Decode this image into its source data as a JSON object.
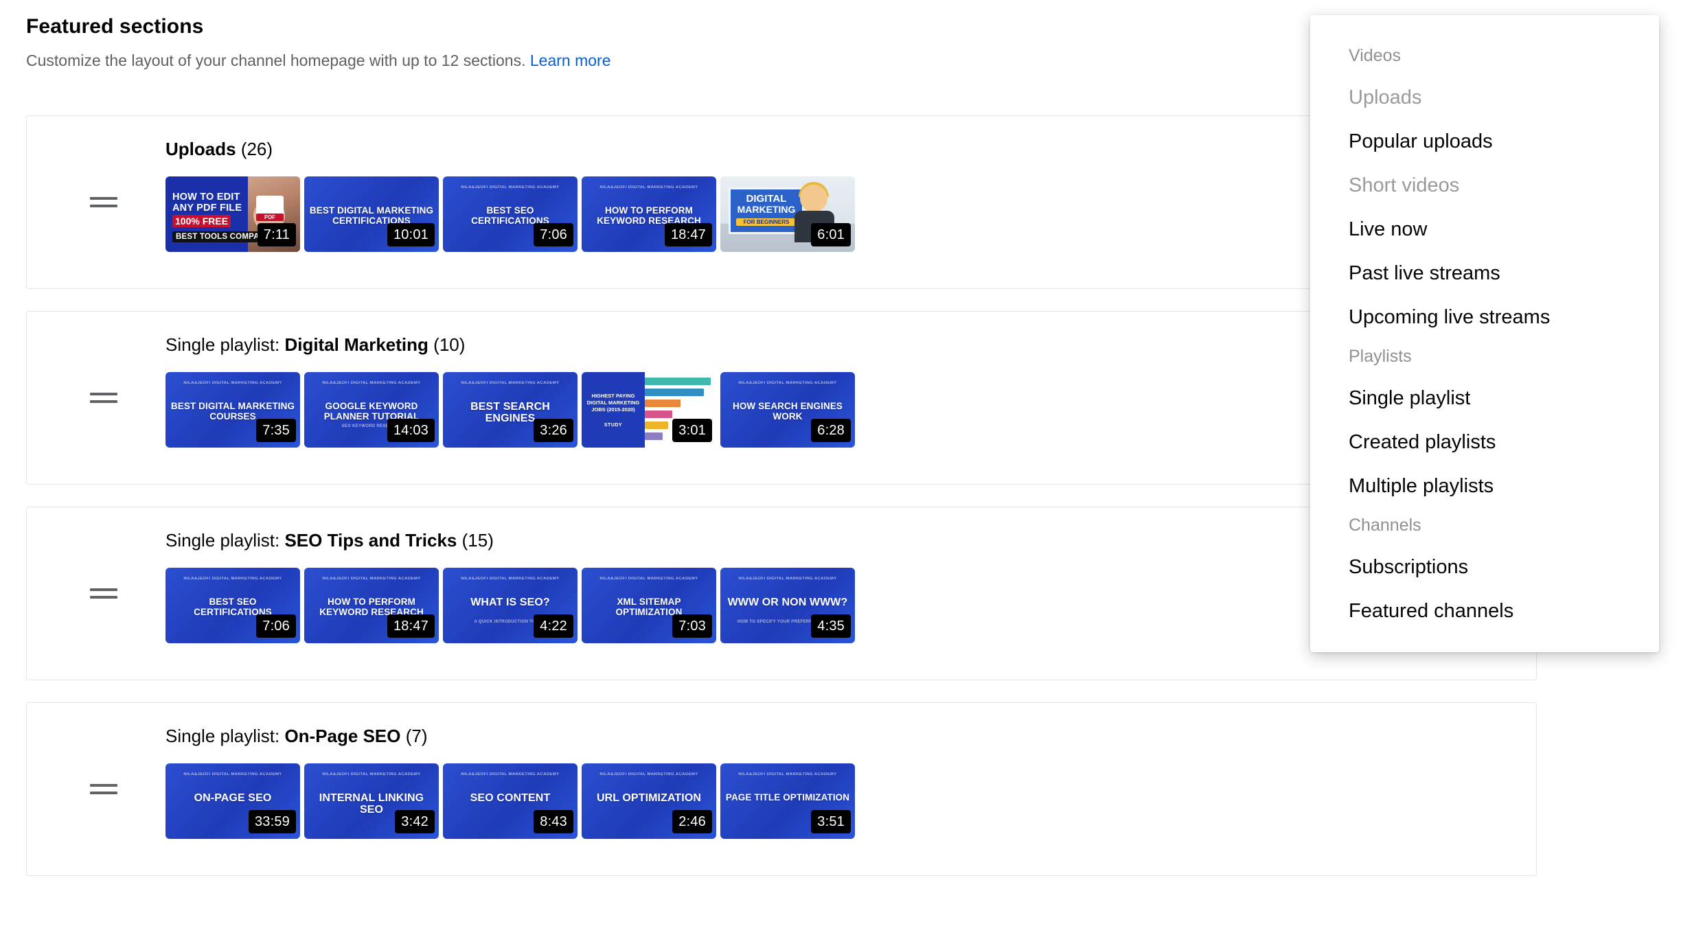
{
  "header": {
    "title": "Featured sections",
    "subtitle": "Customize the layout of your channel homepage with up to 12 sections.",
    "learn_more": "Learn more"
  },
  "sections": [
    {
      "prefix": "",
      "name": "Uploads",
      "count": "(26)",
      "thumbnails": [
        {
          "kind": "pdf",
          "brand": "",
          "title_lines": [
            "HOW TO EDIT",
            "ANY PDF FILE"
          ],
          "badge": "100% FREE",
          "strip": "BEST TOOLS COMPARED",
          "duration": "7:11"
        },
        {
          "kind": "plain",
          "brand": "",
          "title": "BEST DIGITAL MARKETING CERTIFICATIONS",
          "sub": "",
          "duration": "10:01"
        },
        {
          "kind": "plain",
          "brand": "NILA&JEOFI DIGITAL MARKETING ACADEMY",
          "title": "BEST SEO CERTIFICATIONS",
          "sub": "",
          "duration": "7:06"
        },
        {
          "kind": "plain",
          "brand": "NILA&JEOFI DIGITAL MARKETING ACADEMY",
          "title": "HOW TO PERFORM KEYWORD RESEARCH",
          "sub": "",
          "duration": "18:47"
        },
        {
          "kind": "person",
          "board_lines": [
            "DIGITAL",
            "MARKETING"
          ],
          "board_badge": "FOR BEGINNERS",
          "duration": "6:01"
        }
      ]
    },
    {
      "prefix": "Single playlist:",
      "name": "Digital Marketing",
      "count": "(10)",
      "thumbnails": [
        {
          "kind": "plain",
          "brand": "NILA&JEOFI DIGITAL MARKETING ACADEMY",
          "title": "BEST DIGITAL MARKETING COURSES",
          "sub": "",
          "duration": "7:35"
        },
        {
          "kind": "plain",
          "brand": "NILA&JEOFI DIGITAL MARKETING ACADEMY",
          "title": "GOOGLE KEYWORD PLANNER TUTORIAL",
          "sub": "SEO KEYWORD RESEARCH",
          "duration": "14:03"
        },
        {
          "kind": "plain",
          "brand": "NILA&JEOFI DIGITAL MARKETING ACADEMY",
          "title": "BEST SEARCH ENGINES",
          "sub": "",
          "duration": "3:26"
        },
        {
          "kind": "chart",
          "chart_title": "HIGHEST PAYING DIGITAL MARKETING JOBS (2015-2020)",
          "chart_sub": "STUDY",
          "duration": "3:01"
        },
        {
          "kind": "plain",
          "brand": "NILA&JEOFI DIGITAL MARKETING ACADEMY",
          "title": "HOW SEARCH ENGINES WORK",
          "sub": "",
          "duration": "6:28"
        }
      ]
    },
    {
      "prefix": "Single playlist:",
      "name": "SEO Tips and Tricks",
      "count": "(15)",
      "thumbnails": [
        {
          "kind": "plain",
          "brand": "NILA&JEOFI DIGITAL MARKETING ACADEMY",
          "title": "BEST SEO CERTIFICATIONS",
          "sub": "",
          "duration": "7:06"
        },
        {
          "kind": "plain",
          "brand": "NILA&JEOFI DIGITAL MARKETING ACADEMY",
          "title": "HOW TO PERFORM KEYWORD RESEARCH",
          "sub": "",
          "duration": "18:47"
        },
        {
          "kind": "plain",
          "brand": "NILA&JEOFI DIGITAL MARKETING ACADEMY",
          "title": "WHAT IS SEO?",
          "sub": "A QUICK INTRODUCTION TO SEO",
          "duration": "4:22"
        },
        {
          "kind": "plain",
          "brand": "NILA&JEOFI DIGITAL MARKETING ACADEMY",
          "title": "XML SITEMAP OPTIMIZATION",
          "sub": "",
          "duration": "7:03"
        },
        {
          "kind": "plain",
          "brand": "NILA&JEOFI DIGITAL MARKETING ACADEMY",
          "title": "WWW OR NON WWW?",
          "sub": "HOW TO SPECIFY YOUR PREFERRED DOMAIN",
          "duration": "4:35"
        }
      ]
    },
    {
      "prefix": "Single playlist:",
      "name": "On-Page SEO",
      "count": "(7)",
      "thumbnails": [
        {
          "kind": "plain",
          "brand": "NILA&JEOFI DIGITAL MARKETING ACADEMY",
          "title": "ON-PAGE SEO",
          "sub": "",
          "duration": "33:59"
        },
        {
          "kind": "plain",
          "brand": "NILA&JEOFI DIGITAL MARKETING ACADEMY",
          "title": "INTERNAL LINKING SEO",
          "sub": "",
          "duration": "3:42"
        },
        {
          "kind": "plain",
          "brand": "NILA&JEOFI DIGITAL MARKETING ACADEMY",
          "title": "SEO CONTENT",
          "sub": "",
          "duration": "8:43"
        },
        {
          "kind": "plain",
          "brand": "NILA&JEOFI DIGITAL MARKETING ACADEMY",
          "title": "URL OPTIMIZATION",
          "sub": "",
          "duration": "2:46"
        },
        {
          "kind": "plain",
          "brand": "NILA&JEOFI DIGITAL MARKETING ACADEMY",
          "title": "PAGE TITLE OPTIMIZATION",
          "sub": "",
          "duration": "3:51"
        }
      ]
    }
  ],
  "dropdown": {
    "entries": [
      {
        "type": "group",
        "label": "Videos"
      },
      {
        "type": "item",
        "label": "Uploads",
        "disabled": true
      },
      {
        "type": "item",
        "label": "Popular uploads",
        "disabled": false
      },
      {
        "type": "item",
        "label": "Short videos",
        "disabled": true
      },
      {
        "type": "item",
        "label": "Live now",
        "disabled": false
      },
      {
        "type": "item",
        "label": "Past live streams",
        "disabled": false
      },
      {
        "type": "item",
        "label": "Upcoming live streams",
        "disabled": false
      },
      {
        "type": "group",
        "label": "Playlists"
      },
      {
        "type": "item",
        "label": "Single playlist",
        "disabled": false
      },
      {
        "type": "item",
        "label": "Created playlists",
        "disabled": false
      },
      {
        "type": "item",
        "label": "Multiple playlists",
        "disabled": false
      },
      {
        "type": "group",
        "label": "Channels"
      },
      {
        "type": "item",
        "label": "Subscriptions",
        "disabled": false
      },
      {
        "type": "item",
        "label": "Featured channels",
        "disabled": false
      }
    ]
  },
  "colors": {
    "link": "#065fd4",
    "text": "#030303",
    "muted": "#606060",
    "disabled": "#9a9a9a",
    "thumb_blue": "#1f3bb8",
    "border": "#e5e5e5"
  }
}
